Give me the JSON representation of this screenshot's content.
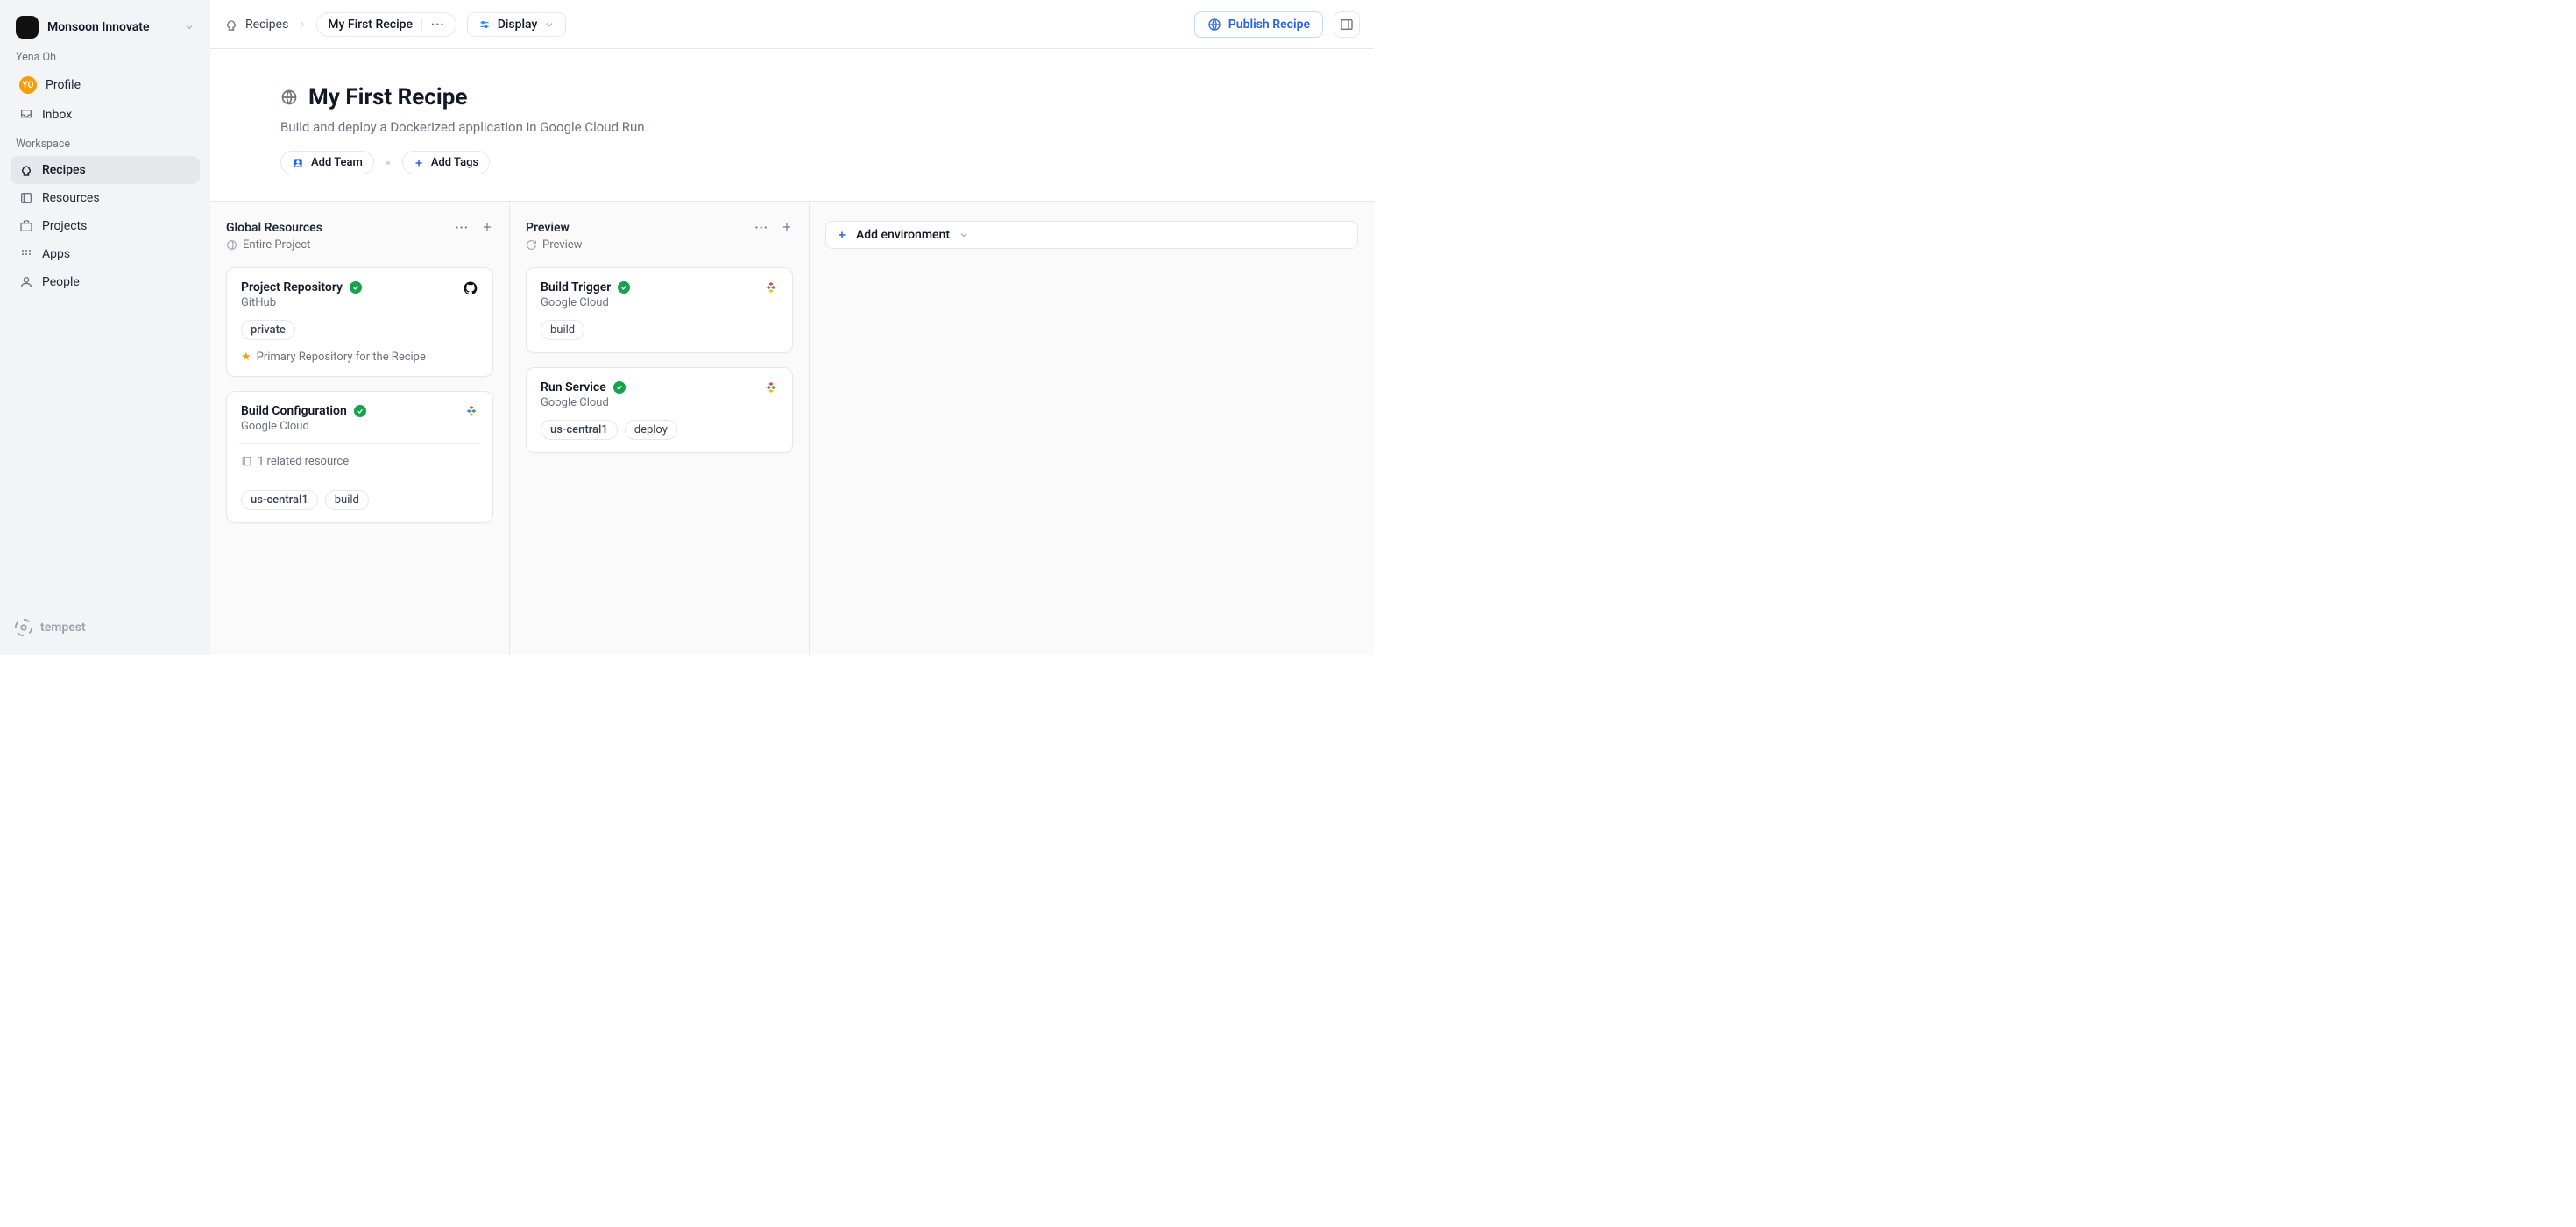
{
  "sidebar": {
    "org_name": "Monsoon Innovate",
    "user_section_label": "Yena Oh",
    "user_initials": "YO",
    "user_items": [
      {
        "label": "Profile"
      },
      {
        "label": "Inbox"
      }
    ],
    "workspace_label": "Workspace",
    "workspace_items": [
      {
        "label": "Recipes",
        "active": true
      },
      {
        "label": "Resources"
      },
      {
        "label": "Projects"
      },
      {
        "label": "Apps"
      },
      {
        "label": "People"
      }
    ],
    "footer_brand": "tempest"
  },
  "topbar": {
    "crumb_root": "Recipes",
    "crumb_current": "My First Recipe",
    "display_label": "Display",
    "publish_label": "Publish Recipe"
  },
  "header": {
    "title": "My First Recipe",
    "subtitle": "Build and deploy a Dockerized application in Google Cloud Run",
    "add_team_label": "Add Team",
    "add_tags_label": "Add Tags"
  },
  "board": {
    "add_env_label": "Add environment",
    "columns": [
      {
        "title": "Global Resources",
        "scope": "Entire Project"
      },
      {
        "title": "Preview",
        "scope": "Preview"
      }
    ],
    "cards_col0": [
      {
        "title": "Project Repository",
        "provider": "GitHub",
        "tags": [
          "private"
        ],
        "note": "Primary Repository for the Recipe"
      },
      {
        "title": "Build Configuration",
        "provider": "Google Cloud",
        "related": "1 related resource",
        "tags": [
          "us-central1",
          "build"
        ]
      }
    ],
    "cards_col1": [
      {
        "title": "Build Trigger",
        "provider": "Google Cloud",
        "tags": [
          "build"
        ]
      },
      {
        "title": "Run Service",
        "provider": "Google Cloud",
        "tags": [
          "us-central1",
          "deploy"
        ]
      }
    ]
  }
}
